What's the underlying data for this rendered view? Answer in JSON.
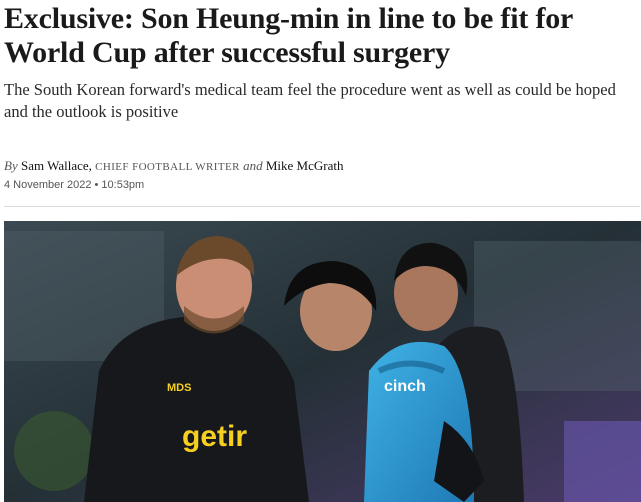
{
  "article": {
    "headline_line1": "Exclusive: Son Heung-min in line to be fit for",
    "headline_line2": "World Cup after successful surgery",
    "standfirst_line1": "The South Korean forward's medical team feel the procedure went as well as could be hoped",
    "standfirst_line2": "and the outlook is positive",
    "byline": {
      "by": "By",
      "author1": "Sam Wallace,",
      "author1_role": "CHIEF FOOTBALL WRITER",
      "and": "and",
      "author2": "Mike McGrath"
    },
    "date": "4 November 2022 • 10:53pm"
  },
  "photo": {
    "description_icon": "photo",
    "staff_crest_text": "MDS",
    "sponsor_logo": "getir",
    "player_shirt_sponsor": "cinch",
    "colors": {
      "sponsor_yellow": "#f5d021",
      "kit_blue": "#2e9fd6",
      "staff_black": "#16181b"
    }
  }
}
